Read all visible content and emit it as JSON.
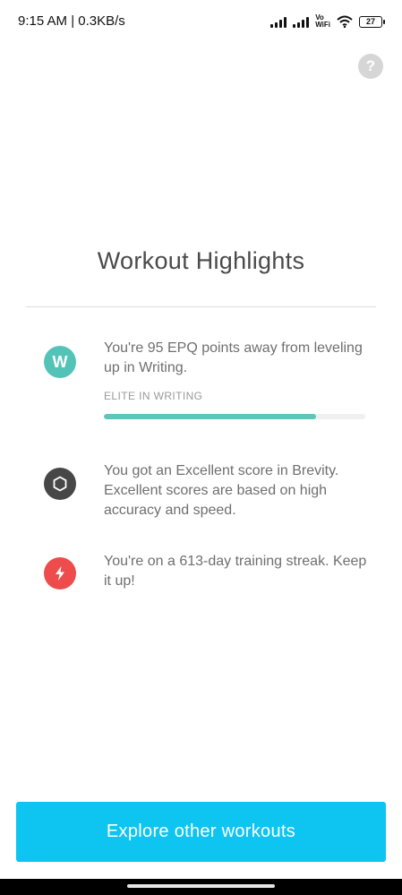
{
  "status_bar": {
    "time": "9:15 AM | 0.3KB/s",
    "vo_wifi_top": "Vo",
    "vo_wifi_bottom": "WiFi",
    "battery": "27",
    "icons": [
      "signal-icon",
      "signal-icon",
      "vowifi-icon",
      "wifi-icon",
      "battery-icon"
    ]
  },
  "help": {
    "label": "?"
  },
  "title": "Workout Highlights",
  "highlights": [
    {
      "icon": "w-letter-icon",
      "icon_label": "W",
      "icon_color": "#54c3b7",
      "text": "You're 95 EPQ points away from leveling up in Writing.",
      "subtitle": "ELITE IN WRITING",
      "progress": 0.81,
      "progress_color": "#5cc6b8"
    },
    {
      "icon": "hexagon-icon",
      "icon_color": "#474747",
      "text": "You got an Excellent score in Brevity. Excellent scores are based on high accuracy and speed."
    },
    {
      "icon": "lightning-bolt-icon",
      "icon_color": "#ee4c4c",
      "text": "You're on a 613-day training streak. Keep it up!"
    }
  ],
  "cta": {
    "label": "Explore other workouts",
    "color": "#0ec4f1"
  }
}
